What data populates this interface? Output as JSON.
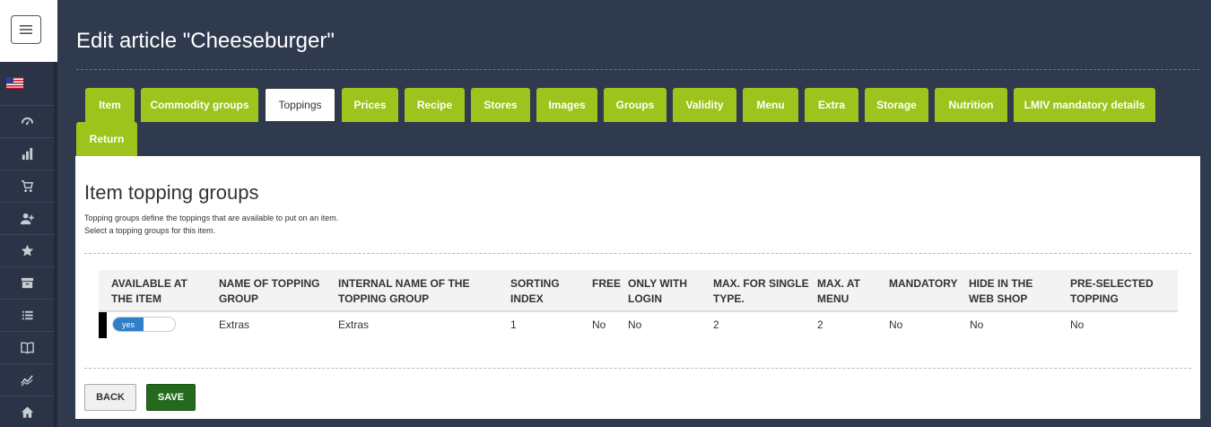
{
  "header": {
    "title": "Edit article \"Cheeseburger\""
  },
  "tabs": [
    {
      "label": "Item"
    },
    {
      "label": "Commodity groups"
    },
    {
      "label": "Toppings"
    },
    {
      "label": "Prices"
    },
    {
      "label": "Recipe"
    },
    {
      "label": "Stores"
    },
    {
      "label": "Images"
    },
    {
      "label": "Groups"
    },
    {
      "label": "Validity"
    },
    {
      "label": "Menu"
    },
    {
      "label": "Extra"
    },
    {
      "label": "Storage"
    },
    {
      "label": "Nutrition"
    },
    {
      "label": "LMIV mandatory details"
    },
    {
      "label": "Return"
    }
  ],
  "active_tab": "Toppings",
  "section": {
    "title": "Item topping groups",
    "desc1": "Topping groups define the toppings that are available to put on an item.",
    "desc2": "Select a topping groups for this item."
  },
  "table": {
    "headers": {
      "available": [
        "AVAILABLE AT",
        "THE ITEM"
      ],
      "name": [
        "NAME OF TOPPING",
        "GROUP"
      ],
      "internal": [
        "INTERNAL NAME OF THE",
        "TOPPING GROUP"
      ],
      "sorting": [
        "SORTING",
        "INDEX"
      ],
      "free": [
        "FREE"
      ],
      "login": [
        "ONLY WITH",
        "LOGIN"
      ],
      "max_single": [
        "MAX. FOR SINGLE",
        "TYPE."
      ],
      "max_menu": [
        "MAX. AT",
        "MENU"
      ],
      "mandatory": [
        "MANDATORY"
      ],
      "hide": [
        "HIDE IN THE",
        "WEB SHOP"
      ],
      "preselected": [
        "PRE-SELECTED",
        "TOPPING"
      ]
    },
    "row": {
      "available_toggle": "yes",
      "name": "Extras",
      "internal": "Extras",
      "sorting": "1",
      "free": "No",
      "login": "No",
      "max_single": "2",
      "max_menu": "2",
      "mandatory": "No",
      "hide": "No",
      "preselected": "No"
    }
  },
  "buttons": {
    "back": "BACK",
    "save": "SAVE"
  },
  "colors": {
    "tab_green": "#9cc41c",
    "save_green": "#236a1e",
    "toggle_blue": "#2f7fc9",
    "bg_dark": "#2f3a4f"
  },
  "sidebar": {
    "icons": [
      "us-flag-icon",
      "dashboard-gauge-icon",
      "bar-chart-icon",
      "cart-icon",
      "add-user-icon",
      "star-icon",
      "archive-icon",
      "list-icon",
      "book-icon",
      "trend-icon",
      "home-icon"
    ]
  }
}
